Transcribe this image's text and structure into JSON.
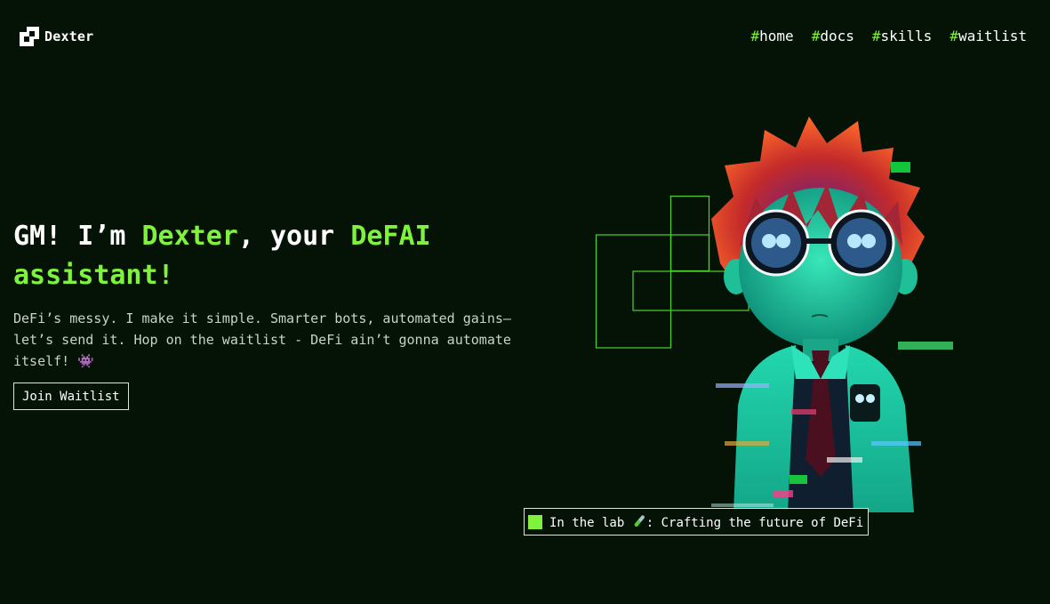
{
  "header": {
    "brand": "Dexter",
    "nav": [
      {
        "hash": "#",
        "label": "home"
      },
      {
        "hash": "#",
        "label": "docs"
      },
      {
        "hash": "#",
        "label": "skills"
      },
      {
        "hash": "#",
        "label": "waitlist"
      }
    ]
  },
  "hero": {
    "title_part1": "GM! I’m ",
    "title_accent1": "Dexter",
    "title_part2": ", your ",
    "title_accent2": "DeFAI",
    "title_accent3": "assistant!",
    "subtitle": "DeFi’s messy. I make it simple. Smarter bots, automated gains—let’s send it. Hop on the waitlist - DeFi ain’t gonna automate itself! 👾",
    "cta_label": "Join Waitlist"
  },
  "status": {
    "label": "In the lab",
    "text": ": Crafting the future of DeFi"
  },
  "colors": {
    "background": "#041305",
    "accent": "#7ff23d",
    "text": "#ffffff"
  }
}
